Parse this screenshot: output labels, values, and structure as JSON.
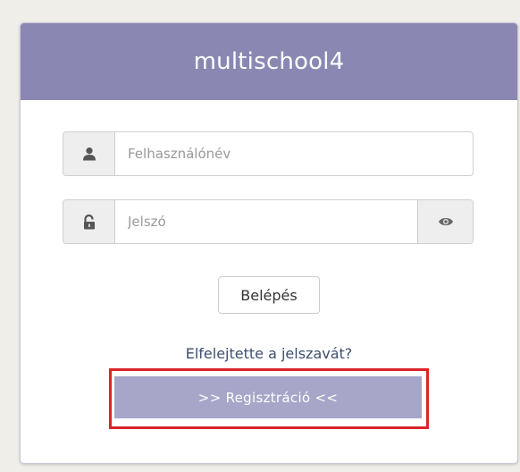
{
  "header": {
    "title": "multischool4"
  },
  "username": {
    "placeholder": "Felhasználónév",
    "value": "",
    "icon": "user-icon"
  },
  "password": {
    "placeholder": "Jelszó",
    "value": "",
    "icon": "unlock-icon",
    "toggle_icon": "eye-icon"
  },
  "login_button": {
    "label": "Belépés"
  },
  "forgot_link": {
    "label": "Elfelejtette a jelszavát?"
  },
  "register_button": {
    "label": ">> Regisztráció <<"
  },
  "colors": {
    "header_bg": "#8a88b3",
    "register_bg": "#a7a6c8",
    "highlight": "#d9252b",
    "page_bg": "#efeee9"
  }
}
